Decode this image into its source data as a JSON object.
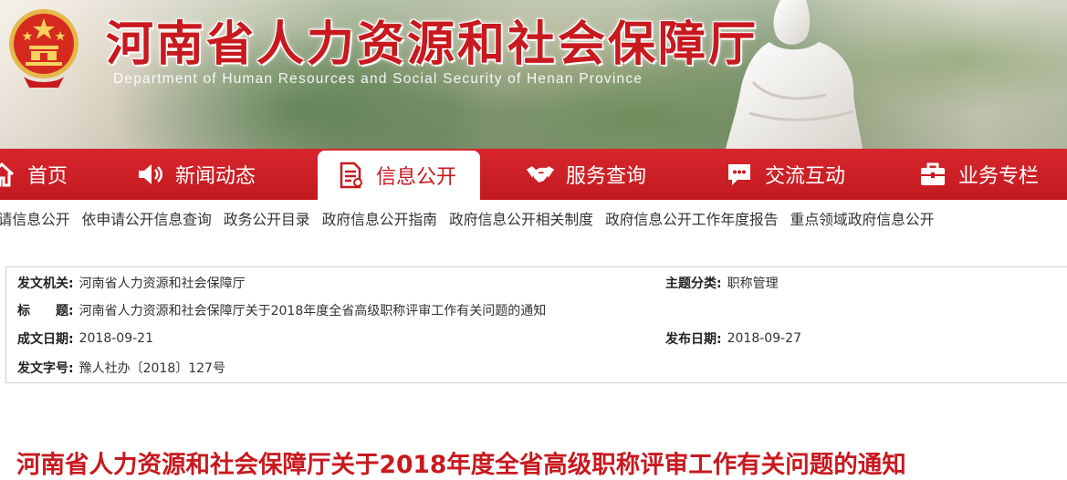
{
  "header": {
    "title": "河南省人力资源和社会保障厅",
    "subtitle": "Department of Human Resources and Social Security of Henan Province"
  },
  "nav": {
    "items": [
      {
        "label": "首页",
        "icon": "home-icon"
      },
      {
        "label": "新闻动态",
        "icon": "speaker-icon"
      },
      {
        "label": "信息公开",
        "icon": "document-icon",
        "active": true
      },
      {
        "label": "服务查询",
        "icon": "handshake-icon"
      },
      {
        "label": "交流互动",
        "icon": "chat-icon"
      },
      {
        "label": "业务专栏",
        "icon": "briefcase-icon"
      }
    ]
  },
  "subnav": {
    "items": [
      "依申请信息公开",
      "依申请公开信息查询",
      "政务公开目录",
      "政府信息公开指南",
      "政府信息公开相关制度",
      "政府信息公开工作年度报告",
      "重点领域政府信息公开"
    ]
  },
  "info": {
    "issuer_label": "发文机关:",
    "issuer": "河南省人力资源和社会保障厅",
    "category_label": "主题分类:",
    "category": "职称管理",
    "title_label": "标　　题:",
    "title": "河南省人力资源和社会保障厅关于2018年度全省高级职称评审工作有关问题的通知",
    "written_date_label": "成文日期:",
    "written_date": "2018-09-21",
    "publish_date_label": "发布日期:",
    "publish_date": "2018-09-27",
    "doc_no_label": "发文字号:",
    "doc_no": "豫人社办〔2018〕127号"
  },
  "article": {
    "title": "河南省人力资源和社会保障厅关于2018年度全省高级职称评审工作有关问题的通知"
  },
  "colors": {
    "brand_red": "#c8191f",
    "nav_red": "#d7262c"
  }
}
